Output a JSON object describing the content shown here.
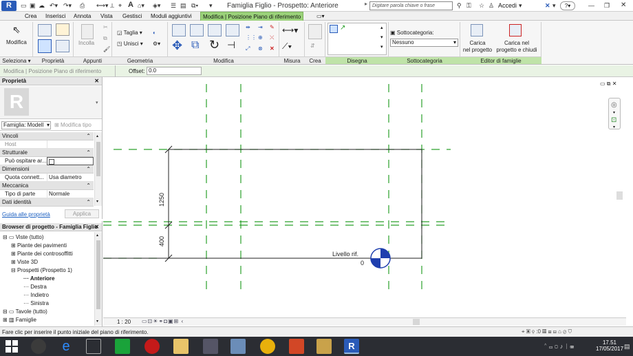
{
  "title_bar": {
    "app_button": "R",
    "window_title": "Famiglia Figlio - Prospetto: Anteriore",
    "search_placeholder": "Digitare parola chiave o frase",
    "sign_in": "Accedi",
    "help": "?"
  },
  "menu_tabs": [
    "Crea",
    "Inserisci",
    "Annota",
    "Vista",
    "Gestisci",
    "Moduli aggiuntivi",
    "Modifica | Posizione Piano di riferimento"
  ],
  "ribbon": {
    "modifica_label": "Modifica",
    "taglia_label": "Taglia",
    "unisci_label": "Unisci",
    "incolla_label": "Incolla",
    "sottocategoria_label": "Sottocategoria:",
    "sottocategoria_value": "Nessuno",
    "carica_progetto": [
      "Carica",
      "nel progetto"
    ],
    "carica_chiudi": [
      "Carica nel",
      "progetto e chiudi"
    ],
    "panels": [
      "Seleziona",
      "Proprietà",
      "Appunti",
      "Geometria",
      "Modifica",
      "Misura",
      "Crea",
      "Disegna",
      "Sottocategoria",
      "Editor di famiglie"
    ]
  },
  "options_bar": {
    "context_label": "Modifica | Posizione Piano di riferimento",
    "offset_label": "Offset:",
    "offset_value": "0.0"
  },
  "properties": {
    "header": "Proprietà",
    "type_selector": "Famiglia: Modell",
    "edit_type": "Modifica tipo",
    "groups": {
      "vincoli": "Vincoli",
      "strutturale": "Strutturale",
      "dimensioni": "Dimensioni",
      "meccanica": "Meccanica",
      "dati_identita": "Dati identità"
    },
    "rows": {
      "host": "Host",
      "puo_ospitare": "Può ospitare ar...",
      "quota_k": "Quota connett...",
      "quota_v": "Usa diametro",
      "tipo_k": "Tipo di parte",
      "tipo_v": "Normale"
    },
    "help_link": "Guida alle proprietà",
    "apply": "Applica"
  },
  "project_browser": {
    "header": "Browser di progetto - Famiglia Figlio",
    "items": {
      "viste": "Viste (tutto)",
      "piante_pavimenti": "Piante dei pavimenti",
      "piante_controsoffitti": "Piante dei controsoffitti",
      "viste_3d": "Viste 3D",
      "prospetti": "Prospetti (Prospetto 1)",
      "anteriore": "Anteriore",
      "destra": "Destra",
      "indietro": "Indietro",
      "sinistra": "Sinistra",
      "tavole": "Tavole (tutto)",
      "famiglie": "Famiglie"
    }
  },
  "canvas": {
    "dim_upper": "1250",
    "dim_lower": "400",
    "level_name": "Livello rif.",
    "level_value": "0"
  },
  "view_bar": {
    "scale": "1 : 20"
  },
  "status_bar": {
    "message": "Fare clic per inserire il punto iniziale del piano di riferimento.",
    "counter": ":0"
  },
  "taskbar": {
    "time": "17.51",
    "date": "17/05/2017"
  },
  "colors": {
    "reference_plane": "#2aa02a",
    "active_tab": "#9bd27a",
    "app_blue": "#2a5bb8",
    "link": "#1b5fc1"
  }
}
